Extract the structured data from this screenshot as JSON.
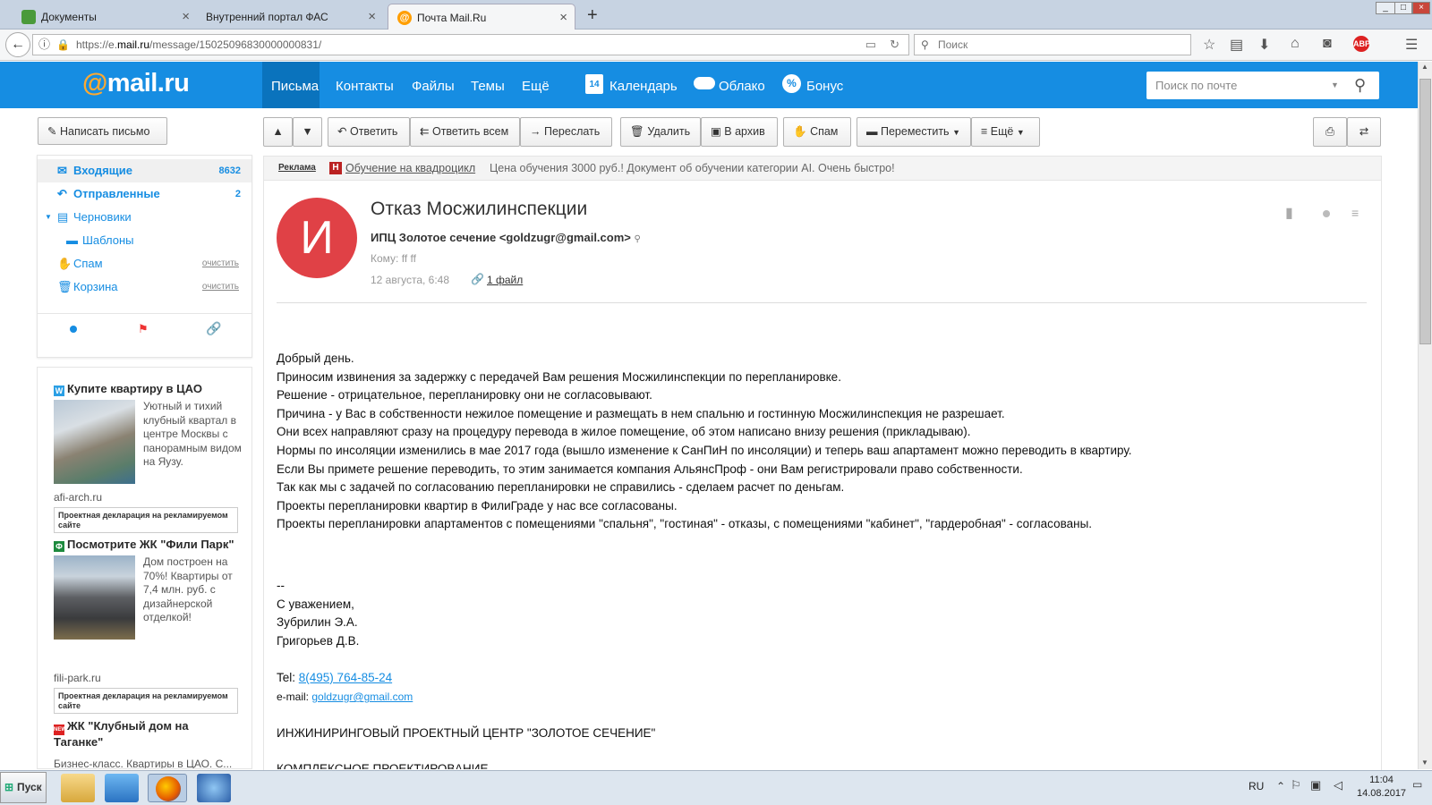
{
  "browser": {
    "tabs": [
      {
        "label": "Документы"
      },
      {
        "label": "Внутренний портал ФАС"
      },
      {
        "label": "Почта Mail.Ru"
      }
    ],
    "url_prefix": "https://e.",
    "url_domain": "mail.ru",
    "url_path": "/message/15025096830000000831/",
    "search_placeholder": "Поиск"
  },
  "header": {
    "logo_at": "@",
    "logo_text": "mail.ru",
    "nav": [
      "Письма",
      "Контакты",
      "Файлы",
      "Темы",
      "Ещё"
    ],
    "services": [
      "Календарь",
      "Облако",
      "Бонус"
    ],
    "calendar_day": "14",
    "search_placeholder": "Поиск по почте"
  },
  "toolbar": {
    "compose": "Написать письмо",
    "reply": "Ответить",
    "reply_all": "Ответить всем",
    "forward": "Переслать",
    "delete": "Удалить",
    "archive": "В архив",
    "spam": "Спам",
    "move": "Переместить",
    "more": "Ещё"
  },
  "folders": [
    {
      "label": "Входящие",
      "count": "8632"
    },
    {
      "label": "Отправленные",
      "count": "2"
    },
    {
      "label": "Черновики"
    },
    {
      "label": "Шаблоны"
    },
    {
      "label": "Спам",
      "action": "очистить"
    },
    {
      "label": "Корзина",
      "action": "очистить"
    }
  ],
  "ads": [
    {
      "title": "Купите квартиру в ЦАО",
      "text": "Уютный и тихий клубный квартал в центре Москвы с панорамным видом на Яузу.",
      "site": "afi-arch.ru",
      "disclaimer": "Проектная декларация на рекламируемом сайте"
    },
    {
      "title": "Посмотрите ЖК \"Фили Парк\"",
      "text": "Дом построен на 70%! Квартиры от 7,4 млн. руб. с дизайнерской отделкой!",
      "site": "fili-park.ru",
      "disclaimer": "Проектная декларация на рекламируемом сайте"
    },
    {
      "title": "ЖК \"Клубный дом на Таганке\"",
      "text": "Бизнес-класс. Квартиры в ЦАО. С..."
    }
  ],
  "promo": {
    "label": "Реклама",
    "link": "Обучение на квадроцикл",
    "text": "Цена обучения 3000 руб.! Документ об обучении категории AI. Очень быстро!"
  },
  "message": {
    "avatar_letter": "И",
    "subject": "Отказ Мосжилинспекции",
    "sender": "ИПЦ Золотое сечение <goldzugr@gmail.com>",
    "recipients": "Кому: ff ff",
    "date": "12 августа, 6:48",
    "attachment": "1 файл",
    "body_lines": [
      "Добрый день.",
      "Приносим извинения за задержку с передачей Вам решения Мосжилинспекции по перепланировке.",
      "Решение - отрицательное, перепланировку они не согласовывают.",
      "Причина - у Вас в собственности нежилое помещение и размещать в нем спальню и гостинную Мосжилинспекция не разрешает.",
      "Они всех направляют сразу на процедуру перевода в жилое помещение, об этом написано внизу решения (прикладываю).",
      "Нормы по инсоляции изменились в мае 2017 года (вышло изменение к СанПиН по инсоляции) и теперь ваш апартамент можно переводить в квартиру.",
      "Если Вы примете решение переводить, то этим занимается компания АльянсПроф - они Вам регистрировали право собственности.",
      "Так как мы с задачей по согласованию перепланировки не справились - сделаем расчет по деньгам.",
      "Проекты перепланировки квартир в ФилиГраде у нас все согласованы.",
      "Проекты перепланировки апартаментов с помещениями \"спальня\", \"гостиная\" - отказы, с помещениями \"кабинет\", \"гардеробная\" - согласованы."
    ],
    "sig_lines": [
      "--",
      "С уважением,",
      "Зубрилин Э.А.",
      "Григорьев Д.В."
    ],
    "tel_label": "Tel:",
    "tel": "8(495) 764-85-24",
    "email_label": "e-mail:",
    "email": "goldzugr@gmail.com",
    "company": "ИНЖИНИРИНГОВЫЙ ПРОЕКТНЫЙ ЦЕНТР \"ЗОЛОТОЕ СЕЧЕНИЕ\"",
    "footer_partial": "КОМПЛЕКСНОЕ ПРОЕКТИРОВАНИЕ"
  },
  "taskbar": {
    "start": "Пуск",
    "lang": "RU",
    "time": "11:04",
    "date": "14.08.2017"
  }
}
